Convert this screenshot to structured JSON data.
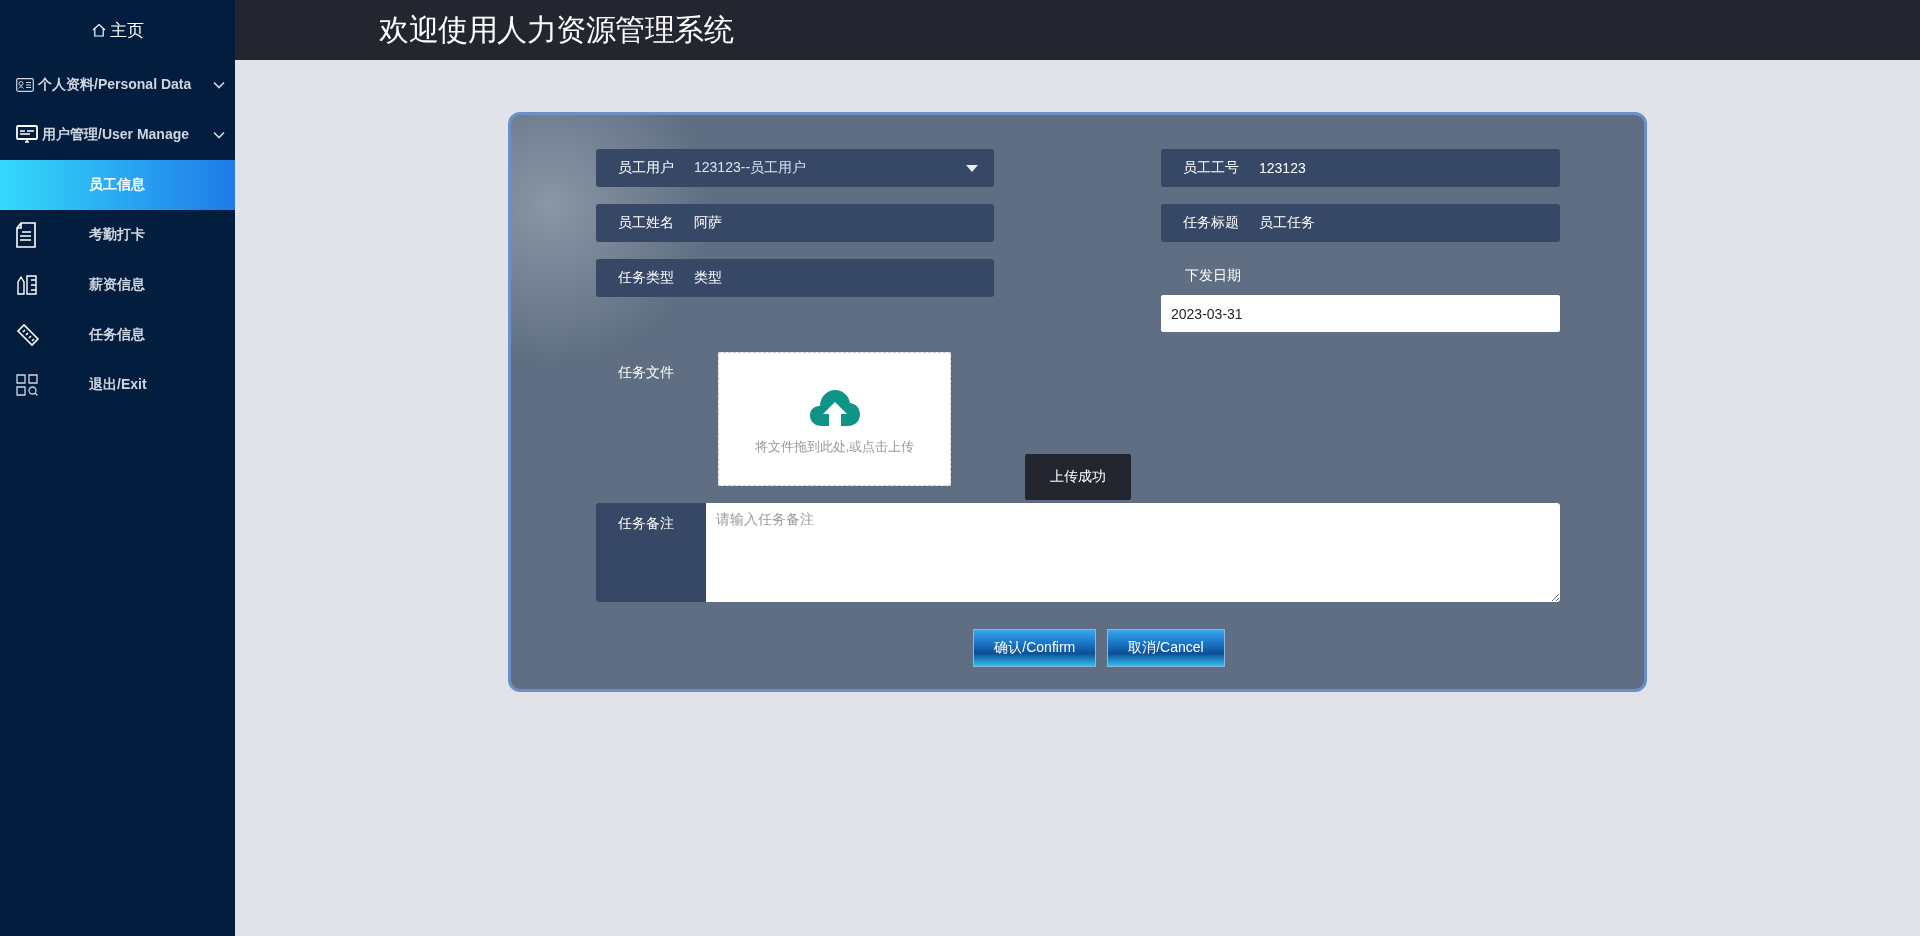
{
  "sidebar": {
    "home": "主页",
    "menus": [
      {
        "label": "个人资料/Personal Data"
      },
      {
        "label": "用户管理/User Manage"
      }
    ],
    "items": [
      {
        "label": "员工信息",
        "selected": true
      },
      {
        "label": "考勤打卡",
        "selected": false
      },
      {
        "label": "薪资信息",
        "selected": false
      },
      {
        "label": "任务信息",
        "selected": false
      },
      {
        "label": "退出/Exit",
        "selected": false
      }
    ]
  },
  "header": {
    "title": "欢迎使用人力资源管理系统"
  },
  "form": {
    "fields": [
      {
        "kind": "select",
        "label": "员工用户",
        "value": "123123--员工用户"
      },
      {
        "kind": "text",
        "label": "员工工号",
        "value": "123123"
      },
      {
        "kind": "text",
        "label": "员工姓名",
        "value": "阿萨"
      },
      {
        "kind": "text",
        "label": "任务标题",
        "value": "员工任务"
      },
      {
        "kind": "text",
        "label": "任务类型",
        "value": "类型"
      },
      {
        "kind": "date",
        "label": "下发日期",
        "value": "2023-03-31"
      }
    ],
    "upload": {
      "label": "任务文件",
      "hint": "将文件拖到此处,或点击上传"
    },
    "toast": "上传成功",
    "remarks": {
      "label": "任务备注",
      "placeholder": "请输入任务备注"
    },
    "buttons": [
      "确认/Confirm",
      "取消/Cancel"
    ]
  }
}
